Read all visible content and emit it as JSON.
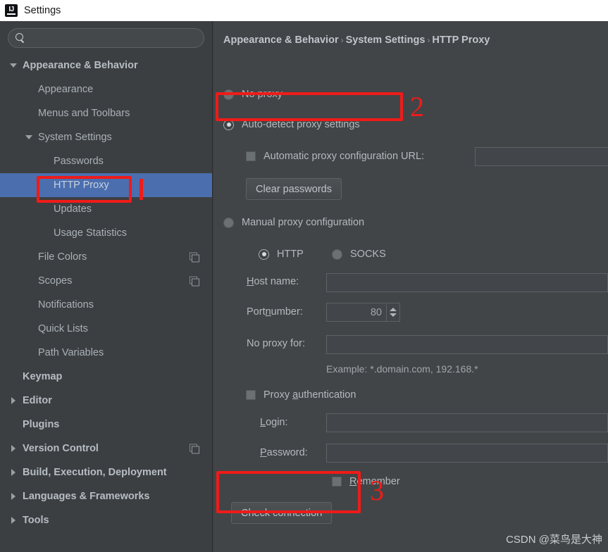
{
  "window": {
    "title": "Settings",
    "app_icon": "intellij-idea-logo"
  },
  "colors": {
    "titlebar_bg": "#ffffff",
    "sidebar_bg": "#3c3f41",
    "main_bg": "#414547",
    "selection_blue": "#4b6eaf",
    "text": "#b3b9be",
    "annotation_red": "#ef1b19"
  },
  "sidebar": {
    "search": {
      "value": "",
      "placeholder": "",
      "icon": "search-icon"
    },
    "items": [
      {
        "label": "Appearance & Behavior",
        "indent": 0,
        "arrow": "down",
        "bold": true,
        "selected": false,
        "copy_icon": false
      },
      {
        "label": "Appearance",
        "indent": 1,
        "arrow": "none",
        "bold": false,
        "selected": false,
        "copy_icon": false
      },
      {
        "label": "Menus and Toolbars",
        "indent": 1,
        "arrow": "none",
        "bold": false,
        "selected": false,
        "copy_icon": false
      },
      {
        "label": "System Settings",
        "indent": 1,
        "arrow": "down",
        "bold": false,
        "selected": false,
        "copy_icon": false
      },
      {
        "label": "Passwords",
        "indent": 2,
        "arrow": "none",
        "bold": false,
        "selected": false,
        "copy_icon": false
      },
      {
        "label": "HTTP Proxy",
        "indent": 2,
        "arrow": "none",
        "bold": false,
        "selected": true,
        "copy_icon": false
      },
      {
        "label": "Updates",
        "indent": 2,
        "arrow": "none",
        "bold": false,
        "selected": false,
        "copy_icon": false
      },
      {
        "label": "Usage Statistics",
        "indent": 2,
        "arrow": "none",
        "bold": false,
        "selected": false,
        "copy_icon": false
      },
      {
        "label": "File Colors",
        "indent": 1,
        "arrow": "none",
        "bold": false,
        "selected": false,
        "copy_icon": true
      },
      {
        "label": "Scopes",
        "indent": 1,
        "arrow": "none",
        "bold": false,
        "selected": false,
        "copy_icon": true
      },
      {
        "label": "Notifications",
        "indent": 1,
        "arrow": "none",
        "bold": false,
        "selected": false,
        "copy_icon": false
      },
      {
        "label": "Quick Lists",
        "indent": 1,
        "arrow": "none",
        "bold": false,
        "selected": false,
        "copy_icon": false
      },
      {
        "label": "Path Variables",
        "indent": 1,
        "arrow": "none",
        "bold": false,
        "selected": false,
        "copy_icon": false
      },
      {
        "label": "Keymap",
        "indent": 0,
        "arrow": "none",
        "bold": true,
        "selected": false,
        "copy_icon": false
      },
      {
        "label": "Editor",
        "indent": 0,
        "arrow": "right",
        "bold": true,
        "selected": false,
        "copy_icon": false
      },
      {
        "label": "Plugins",
        "indent": 0,
        "arrow": "none",
        "bold": true,
        "selected": false,
        "copy_icon": false
      },
      {
        "label": "Version Control",
        "indent": 0,
        "arrow": "right",
        "bold": true,
        "selected": false,
        "copy_icon": true
      },
      {
        "label": "Build, Execution, Deployment",
        "indent": 0,
        "arrow": "right",
        "bold": true,
        "selected": false,
        "copy_icon": false
      },
      {
        "label": "Languages & Frameworks",
        "indent": 0,
        "arrow": "right",
        "bold": true,
        "selected": false,
        "copy_icon": false
      },
      {
        "label": "Tools",
        "indent": 0,
        "arrow": "right",
        "bold": true,
        "selected": false,
        "copy_icon": false
      }
    ]
  },
  "main": {
    "breadcrumb": {
      "part1": "Appearance & Behavior",
      "sep1": "›",
      "part2": "System Settings",
      "sep2": "›",
      "part3": "HTTP Proxy"
    },
    "proxy_mode": {
      "no_proxy": {
        "label": "No proxy",
        "checked": false
      },
      "auto_detect": {
        "label": "Auto-detect proxy settings",
        "checked": true
      },
      "manual": {
        "label": "Manual proxy configuration",
        "checked": false
      }
    },
    "auto_pac": {
      "label": "Automatic proxy configuration URL:",
      "checked": false,
      "url_value": ""
    },
    "clear_passwords_button": "Clear passwords",
    "protocol": {
      "http": {
        "label": "HTTP",
        "checked": true
      },
      "socks": {
        "label": "SOCKS",
        "checked": false
      }
    },
    "host_name": {
      "label_pre": "H",
      "label_post": "ost name:",
      "value": ""
    },
    "port_number": {
      "label_pre": "Port ",
      "label_mn": "n",
      "label_post": "umber:",
      "value": "80"
    },
    "no_proxy_for": {
      "label": "No proxy for:",
      "value": ""
    },
    "example_hint": "Example: *.domain.com, 192.168.*",
    "proxy_auth": {
      "label_pre": "Proxy ",
      "label_mn": "a",
      "label_post": "uthentication",
      "checked": false
    },
    "login": {
      "label_pre": "L",
      "label_post": "ogin:",
      "value": ""
    },
    "password": {
      "label_pre": "P",
      "label_post": "assword:",
      "value": ""
    },
    "remember": {
      "label_pre": "R",
      "label_post": "emember",
      "checked": false
    },
    "check_connection_button": "Check connection",
    "watermark": "CSDN @菜鸟是大神"
  },
  "annotations": {
    "mark1": "",
    "mark2": "2",
    "mark3": "3"
  }
}
